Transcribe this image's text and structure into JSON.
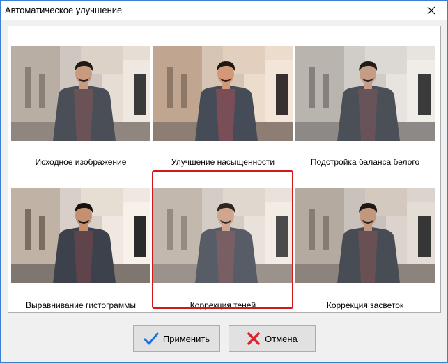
{
  "window": {
    "title": "Автоматическое улучшение"
  },
  "icons": {
    "close": "close-icon",
    "apply": "checkmark-icon",
    "cancel": "red-x-icon"
  },
  "options": [
    {
      "label": "Исходное изображение"
    },
    {
      "label": "Улучшение насыщенности"
    },
    {
      "label": "Подстройка баланса белого"
    },
    {
      "label": "Выравнивание гистограммы"
    },
    {
      "label": "Коррекция теней"
    },
    {
      "label": "Коррекция засветок"
    }
  ],
  "selected_option": "Коррекция теней",
  "buttons": {
    "apply_label": "Применить",
    "cancel_label": "Отмена"
  },
  "colors": {
    "selection_border": "#d01a1a",
    "apply_check": "#1e6fd9",
    "cancel_x": "#d9262a"
  }
}
